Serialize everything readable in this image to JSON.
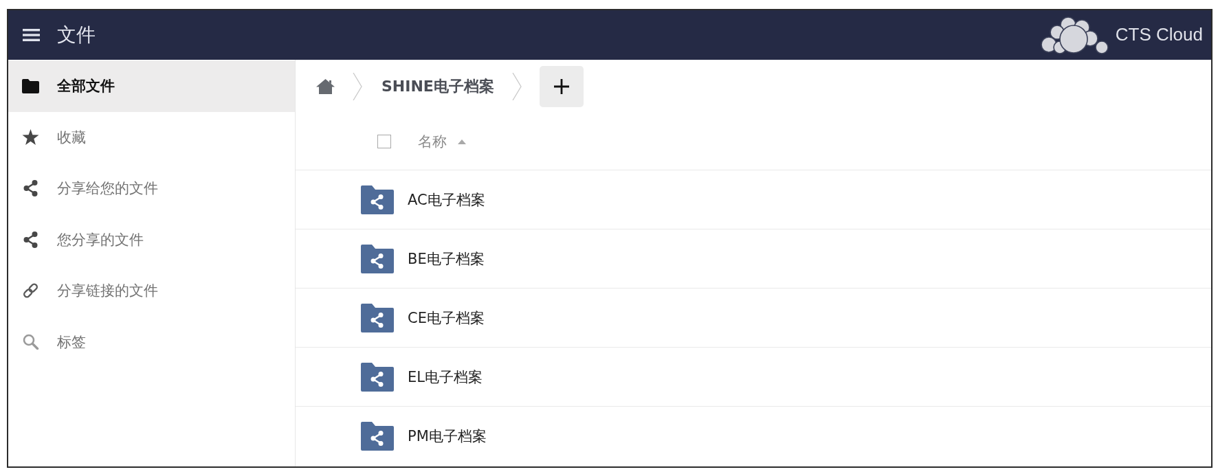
{
  "header": {
    "title": "文件",
    "brand": "CTS Cloud"
  },
  "sidebar": {
    "items": [
      {
        "kind": "folder",
        "label": "全部文件",
        "selected": true
      },
      {
        "kind": "star",
        "label": "收藏",
        "selected": false
      },
      {
        "kind": "share",
        "label": "分享给您的文件",
        "selected": false
      },
      {
        "kind": "share",
        "label": "您分享的文件",
        "selected": false
      },
      {
        "kind": "link",
        "label": "分享链接的文件",
        "selected": false
      },
      {
        "kind": "search",
        "label": "标签",
        "selected": false
      }
    ]
  },
  "breadcrumb": {
    "items": [
      {
        "label": "SHINE电子档案"
      }
    ]
  },
  "file_list": {
    "select_all": {
      "checked": false
    },
    "columns": [
      {
        "label": "名称",
        "sort_ascending": true
      }
    ],
    "rows": [
      {
        "name": "AC电子档案"
      },
      {
        "name": "BE电子档案"
      },
      {
        "name": "CE电子档案"
      },
      {
        "name": "EL电子档案"
      },
      {
        "name": "PM电子档案"
      }
    ]
  }
}
